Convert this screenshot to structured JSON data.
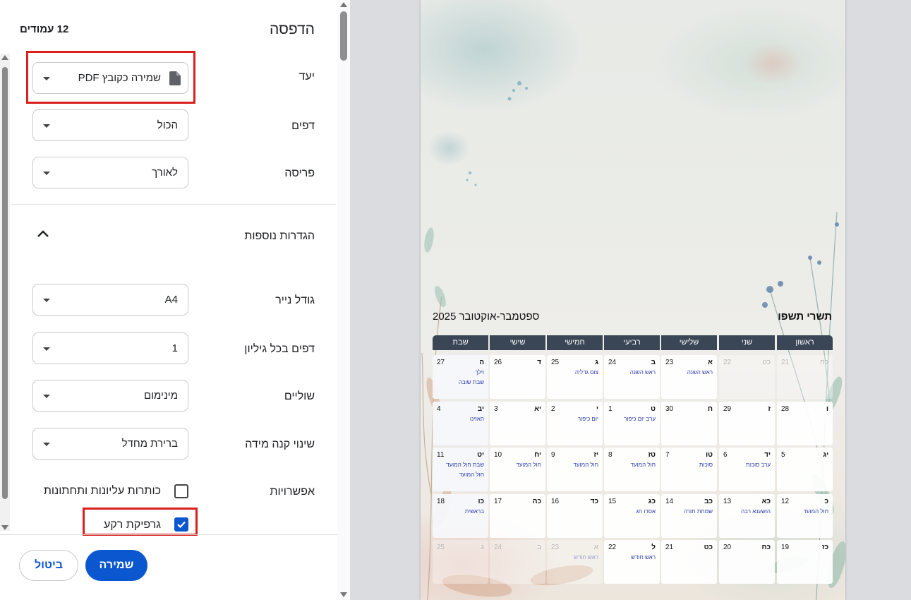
{
  "dialog": {
    "title": "הדפסה",
    "page_count": "12 עמודים",
    "destination": {
      "label": "יעד",
      "value": "שמירה כקובץ PDF"
    },
    "pages": {
      "label": "דפים",
      "value": "הכול"
    },
    "layout": {
      "label": "פריסה",
      "value": "לאורך"
    },
    "more_settings": {
      "label": "הגדרות נוספות"
    },
    "paper_size": {
      "label": "גודל נייר",
      "value": "A4"
    },
    "pages_per_sheet": {
      "label": "דפים בכל גיליון",
      "value": "1"
    },
    "margins": {
      "label": "שוליים",
      "value": "מינימום"
    },
    "scale": {
      "label": "שינוי קנה מידה",
      "value": "ברירת מחדל"
    },
    "options": {
      "label": "אפשרויות",
      "headers_footers": {
        "label": "כותרות עליונות ותחתונות",
        "checked": false
      },
      "background_graphics": {
        "label": "גרפיקת רקע",
        "checked": true
      }
    },
    "save_label": "שמירה",
    "cancel_label": "ביטול",
    "accent_color": "#0b57d0",
    "highlight_color": "#d9201c",
    "icons": {
      "destination": "file-icon",
      "more_settings": "chevron-up-icon"
    }
  },
  "calendar": {
    "title_hebrew": "תשרי תשפו",
    "title_gregorian": "ספטמבר-אוקטובר 2025",
    "header_color": "#3a4656",
    "day_names": [
      "ראשון",
      "שני",
      "שלישי",
      "רביעי",
      "חמישי",
      "שישי",
      "שבת"
    ],
    "weeks": [
      [
        {
          "heb": "כח",
          "greg": "21",
          "faded": true
        },
        {
          "heb": "כט",
          "greg": "22",
          "faded": true
        },
        {
          "heb": "א",
          "greg": "23",
          "events": [
            "ראש השנה"
          ]
        },
        {
          "heb": "ב",
          "greg": "24",
          "events": [
            "ראש השנה"
          ]
        },
        {
          "heb": "ג",
          "greg": "25",
          "events": [
            "צום גדליה"
          ]
        },
        {
          "heb": "ד",
          "greg": "26"
        },
        {
          "heb": "ה",
          "greg": "27",
          "events": [
            "וילך",
            "שבת שובה"
          ],
          "tinted": true
        }
      ],
      [
        {
          "heb": "ו",
          "greg": "28"
        },
        {
          "heb": "ז",
          "greg": "29"
        },
        {
          "heb": "ח",
          "greg": "30"
        },
        {
          "heb": "ט",
          "greg": "1",
          "events": [
            "ערב יום כיפור"
          ]
        },
        {
          "heb": "י",
          "greg": "2",
          "events": [
            "יום כיפור"
          ]
        },
        {
          "heb": "יא",
          "greg": "3"
        },
        {
          "heb": "יב",
          "greg": "4",
          "events": [
            "האזינו"
          ],
          "tinted": true
        }
      ],
      [
        {
          "heb": "יג",
          "greg": "5"
        },
        {
          "heb": "יד",
          "greg": "6",
          "events": [
            "ערב סוכות"
          ]
        },
        {
          "heb": "טו",
          "greg": "7",
          "events": [
            "סוכות"
          ]
        },
        {
          "heb": "טז",
          "greg": "8",
          "events": [
            "חול המועד"
          ]
        },
        {
          "heb": "יז",
          "greg": "9",
          "events": [
            "חול המועד"
          ]
        },
        {
          "heb": "יח",
          "greg": "10",
          "events": [
            "חול המועד"
          ]
        },
        {
          "heb": "יט",
          "greg": "11",
          "events": [
            "שבת חול המועד",
            "חול המועד"
          ],
          "tinted": true
        }
      ],
      [
        {
          "heb": "כ",
          "greg": "12",
          "events": [
            "חול המועד"
          ]
        },
        {
          "heb": "כא",
          "greg": "13",
          "events": [
            "הושענא רבה"
          ]
        },
        {
          "heb": "כב",
          "greg": "14",
          "events": [
            "שמחת תורה"
          ]
        },
        {
          "heb": "כג",
          "greg": "15",
          "events": [
            "אסרו חג"
          ]
        },
        {
          "heb": "כד",
          "greg": "16"
        },
        {
          "heb": "כה",
          "greg": "17"
        },
        {
          "heb": "כו",
          "greg": "18",
          "events": [
            "בראשית"
          ],
          "tinted": true
        }
      ],
      [
        {
          "heb": "כז",
          "greg": "19"
        },
        {
          "heb": "כח",
          "greg": "20"
        },
        {
          "heb": "כט",
          "greg": "21"
        },
        {
          "heb": "ל",
          "greg": "22",
          "events": [
            "ראש חודש"
          ]
        },
        {
          "heb": "א",
          "greg": "23",
          "events": [
            "ראש חודש"
          ],
          "faded": true
        },
        {
          "heb": "ב",
          "greg": "24",
          "faded": true
        },
        {
          "heb": "ג",
          "greg": "25",
          "faded": true
        }
      ]
    ]
  }
}
